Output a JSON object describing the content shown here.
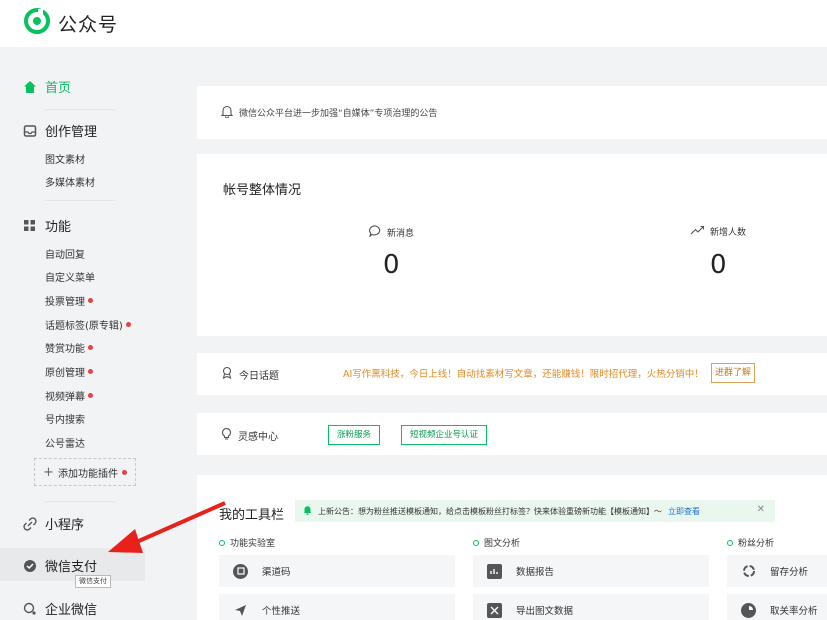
{
  "header": {
    "brand": "公众号"
  },
  "sidebar": {
    "home": "首页",
    "create": {
      "label": "创作管理",
      "items": [
        "图文素材",
        "多媒体素材"
      ]
    },
    "features": {
      "label": "功能",
      "items": [
        {
          "label": "自动回复",
          "dot": false
        },
        {
          "label": "自定义菜单",
          "dot": false
        },
        {
          "label": "投票管理",
          "dot": true
        },
        {
          "label": "话题标签(原专辑)",
          "dot": true
        },
        {
          "label": "赞赏功能",
          "dot": true
        },
        {
          "label": "原创管理",
          "dot": true
        },
        {
          "label": "视频弹幕",
          "dot": true
        },
        {
          "label": "号内搜索",
          "dot": false
        },
        {
          "label": "公号雷达",
          "dot": false
        }
      ],
      "add_plugin": "添加功能插件"
    },
    "miniprogram": "小程序",
    "wechatpay": "微信支付",
    "wework": "企业微信",
    "tooltip": "微信支付"
  },
  "notice": {
    "text": "微信公众平台进一步加强“自媒体”专项治理的公告"
  },
  "overview": {
    "title": "帐号整体情况",
    "new_msg_label": "新消息",
    "new_msg_value": "0",
    "new_users_label": "新增人数",
    "new_users_value": "0"
  },
  "topic": {
    "label": "今日话题",
    "ad": "AI写作黑科技，今日上线！自动找素材写文章，还能赚钱！限时招代理，火热分销中！",
    "join": "进群了解"
  },
  "inspire": {
    "label": "灵感中心",
    "btn1": "涨粉服务",
    "btn2": "短视频企业号认证"
  },
  "tools": {
    "title": "我的工具栏",
    "announce": "上新公告：想为粉丝推送模板通知，给点击模板粉丝打标签？快来体验重磅新功能【模板通知】～",
    "announce_link": "立即查看",
    "lab": {
      "title": "功能实验室",
      "items": [
        "渠道码",
        "个性推送"
      ]
    },
    "article": {
      "title": "图文分析",
      "items": [
        "数据报告",
        "导出图文数据"
      ]
    },
    "fans": {
      "title": "粉丝分析",
      "items": [
        "留存分析",
        "取关率分析"
      ]
    }
  },
  "colors": {
    "accent": "#07c160",
    "dot": "#e64340",
    "ad_text": "#e08a25",
    "link": "#1b6fd6",
    "arrow": "#e8211d"
  },
  "icons": [
    "wechat-mp-logo",
    "home-icon",
    "inbox-icon",
    "grid-icon",
    "link-icon",
    "pay-icon",
    "wework-icon",
    "bell-icon",
    "chat-bubble-icon",
    "trend-icon",
    "trophy-icon",
    "bulb-icon"
  ]
}
